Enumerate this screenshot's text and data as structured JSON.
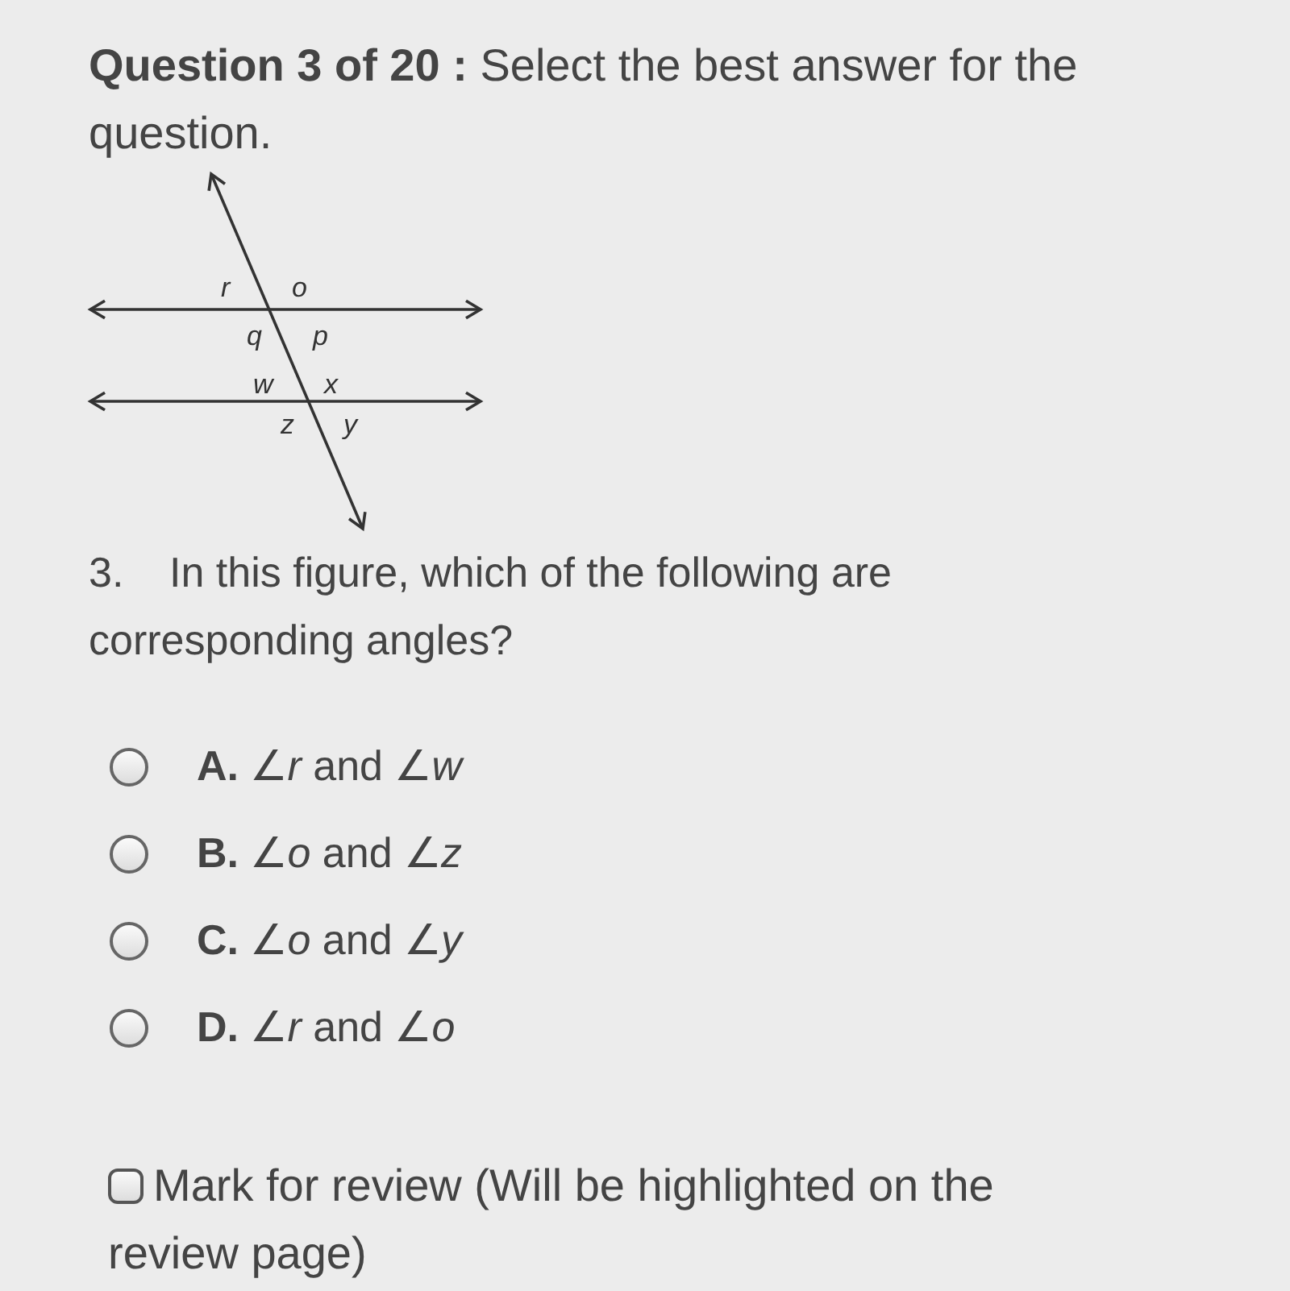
{
  "header": {
    "text": "**Question 3 of 20 :** Select the best answer for the question."
  },
  "figure": {
    "labels": [
      {
        "text": "r"
      },
      {
        "text": "o"
      },
      {
        "text": "q"
      },
      {
        "text": "p"
      },
      {
        "text": "w"
      },
      {
        "text": "x"
      },
      {
        "text": "z"
      },
      {
        "text": "y"
      }
    ]
  },
  "question": {
    "number": "3.",
    "text": "In this figure, which of the following are corresponding angles?"
  },
  "options": [
    {
      "letter": "A.",
      "text": "∠*r* and ∠*w*",
      "selected": false
    },
    {
      "letter": "B.",
      "text": "∠*o* and ∠*z*",
      "selected": false
    },
    {
      "letter": "C.",
      "text": "∠*o* and ∠*y*",
      "selected": false
    },
    {
      "letter": "D.",
      "text": "∠*r* and ∠*o*",
      "selected": false
    }
  ],
  "review": {
    "label": "Mark for review (Will be highlighted on the review page)",
    "checked": false
  }
}
